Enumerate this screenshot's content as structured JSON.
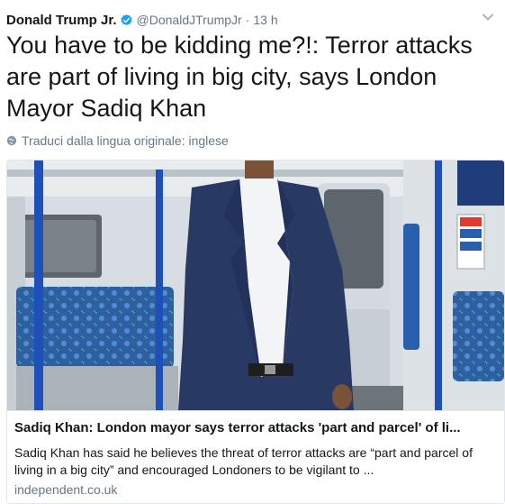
{
  "tweet": {
    "display_name": "Donald Trump Jr.",
    "handle": "@DonaldJTrumpJr",
    "separator": "·",
    "time": "13 h",
    "text": "You have to be kidding me?!: Terror attacks are part of living in big city, says London Mayor Sadiq Khan",
    "translate_label": "Traduci dalla lingua originale: inglese"
  },
  "icons": {
    "verified": "verified-badge-icon",
    "caret": "chevron-down-icon",
    "globe": "globe-icon"
  },
  "colors": {
    "verified_blue": "#1da1f2",
    "secondary_text": "#657786",
    "primary_text": "#14171a",
    "border": "#e1e8ed"
  },
  "card": {
    "title": "Sadiq Khan: London mayor says terror attacks 'part and parcel' of li...",
    "description": "Sadiq Khan has said he believes the threat of terror attacks are “part and parcel of living in a big city” and encouraged Londoners to be vigilant to ...",
    "domain": "independent.co.uk"
  }
}
